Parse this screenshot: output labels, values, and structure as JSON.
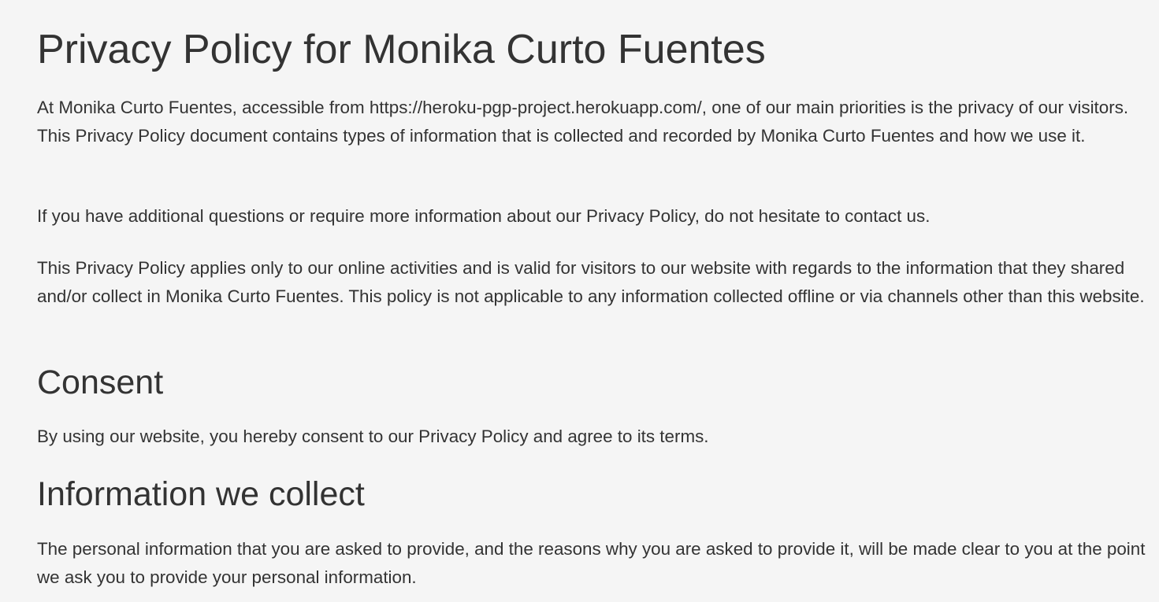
{
  "page": {
    "title": "Privacy Policy for Monika Curto Fuentes",
    "intro_paragraphs": [
      "At Monika Curto Fuentes, accessible from https://heroku-pgp-project.herokuapp.com/, one of our main priorities is the privacy of our visitors. This Privacy Policy document contains types of information that is collected and recorded by Monika Curto Fuentes and how we use it.",
      "If you have additional questions or require more information about our Privacy Policy, do not hesitate to contact us.",
      "This Privacy Policy applies only to our online activities and is valid for visitors to our website with regards to the information that they shared and/or collect in Monika Curto Fuentes. This policy is not applicable to any information collected offline or via channels other than this website."
    ],
    "sections": [
      {
        "heading": "Consent",
        "body": "By using our website, you hereby consent to our Privacy Policy and agree to its terms."
      },
      {
        "heading": "Information we collect",
        "body": "The personal information that you are asked to provide, and the reasons why you are asked to provide it, will be made clear to you at the point we ask you to provide your personal information."
      }
    ]
  },
  "colors": {
    "background": "#f5f5f5",
    "text": "#333333"
  }
}
